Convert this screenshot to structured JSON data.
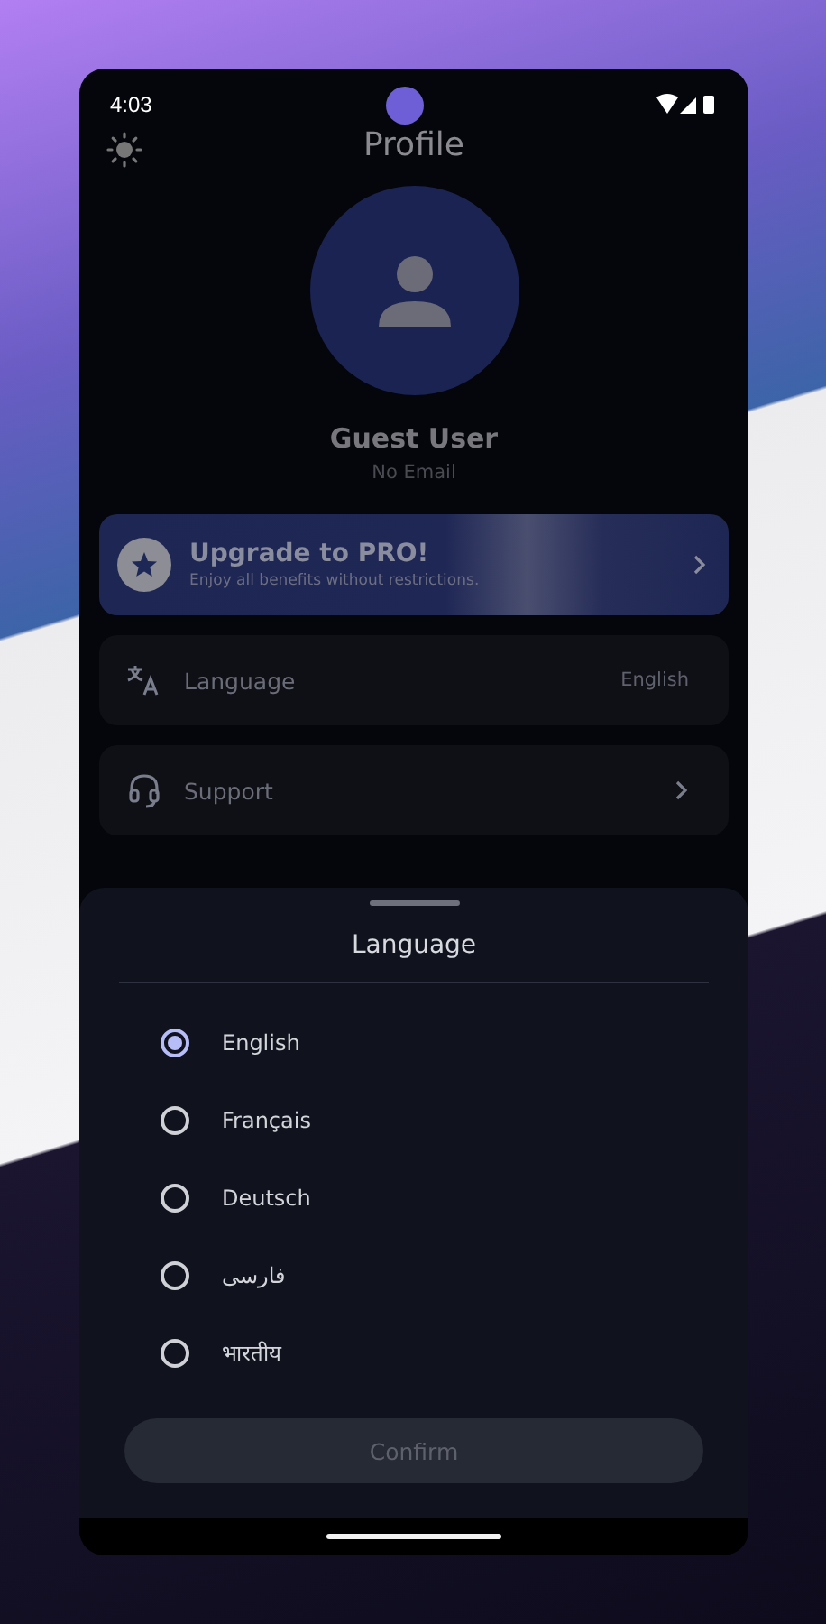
{
  "status_bar": {
    "time": "4:03"
  },
  "header": {
    "title": "Profile"
  },
  "profile": {
    "name": "Guest User",
    "email": "No Email"
  },
  "pro_banner": {
    "title": "Upgrade to PRO!",
    "subtitle": "Enjoy all benefits without restrictions."
  },
  "settings": [
    {
      "kind": "value",
      "label": "Language",
      "value": "English"
    },
    {
      "kind": "link",
      "label": "Support"
    }
  ],
  "sheet": {
    "title": "Language",
    "options": [
      {
        "label": "English",
        "selected": true
      },
      {
        "label": "Français",
        "selected": false
      },
      {
        "label": "Deutsch",
        "selected": false
      },
      {
        "label": "فارسی",
        "selected": false
      },
      {
        "label": "भारतीय",
        "selected": false
      }
    ],
    "confirm": {
      "label": "Confirm",
      "disabled": true
    }
  }
}
